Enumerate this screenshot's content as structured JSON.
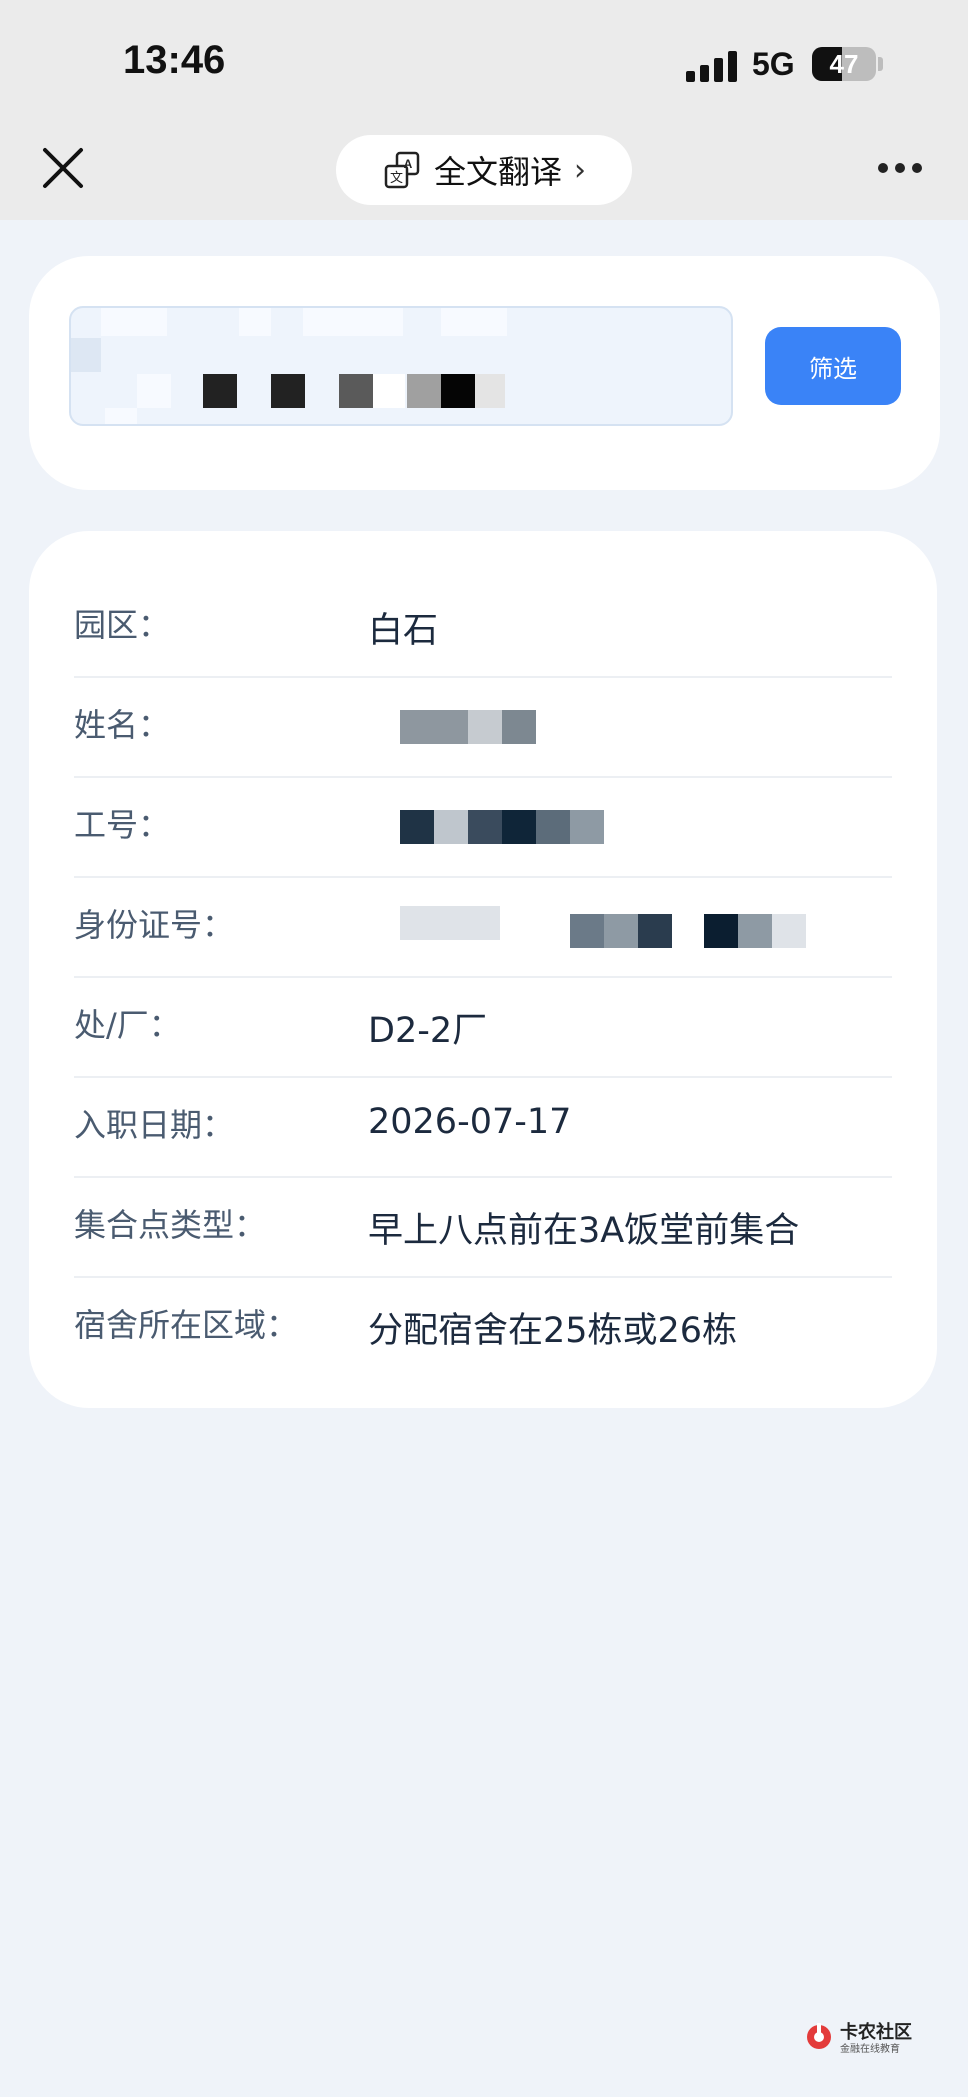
{
  "status_bar": {
    "time": "13:46",
    "network": "5G",
    "battery": "47",
    "battery_level": 0.47
  },
  "nav": {
    "translate_label": "全文翻译",
    "translate_chevron": "›"
  },
  "search": {
    "placeholder": "",
    "filter_label": "筛选"
  },
  "info": {
    "rows": [
      {
        "label": "园区：",
        "value": "白石"
      },
      {
        "label": "姓名：",
        "value": ""
      },
      {
        "label": "工号：",
        "value": ""
      },
      {
        "label": "身份证号：",
        "value": ""
      },
      {
        "label": "处/厂：",
        "value": "D2-2厂"
      },
      {
        "label": "入职日期：",
        "value": "2026-07-17"
      },
      {
        "label": "集合点类型：",
        "value": "早上八点前在3A饭堂前集合"
      },
      {
        "label": "宿舍所在区域：",
        "value": "分配宿舍在25栋或26栋"
      }
    ]
  },
  "watermark": {
    "title": "卡农社区",
    "subtitle": "金融在线教育"
  },
  "colors": {
    "accent": "#3a83f7",
    "label": "#4a5b70",
    "value": "#1c2a3e",
    "background": "#eff3f9"
  }
}
